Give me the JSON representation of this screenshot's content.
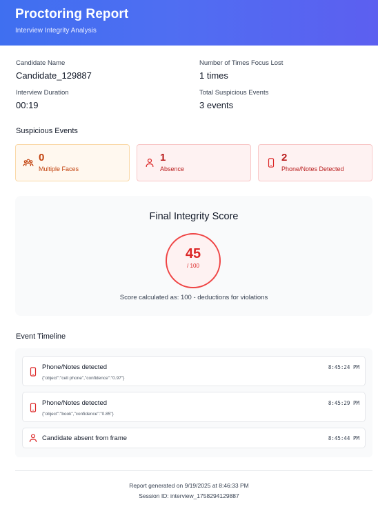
{
  "header": {
    "title": "Proctoring Report",
    "subtitle": "Interview Integrity Analysis"
  },
  "info": {
    "candidate_name_label": "Candidate Name",
    "candidate_name": "Candidate_129887",
    "focus_lost_label": "Number of Times Focus Lost",
    "focus_lost": "1 times",
    "duration_label": "Interview Duration",
    "duration": "00:19",
    "suspicious_total_label": "Total Suspicious Events",
    "suspicious_total": "3 events"
  },
  "suspicious": {
    "title": "Suspicious Events",
    "cards": [
      {
        "count": "0",
        "label": "Multiple Faces",
        "icon": "users-icon",
        "color": "#c2410c"
      },
      {
        "count": "1",
        "label": "Absence",
        "icon": "user-icon",
        "color": "#b91c1c"
      },
      {
        "count": "2",
        "label": "Phone/Notes Detected",
        "icon": "phone-icon",
        "color": "#b91c1c"
      }
    ]
  },
  "score": {
    "title": "Final Integrity Score",
    "value": "45",
    "max": "/ 100",
    "note": "Score calculated as: 100 - deductions for violations",
    "accent": "#dc2626"
  },
  "timeline": {
    "title": "Event Timeline",
    "items": [
      {
        "title": "Phone/Notes detected",
        "detail": "{\"object\":\"cell phone\",\"confidence\":\"0.97\"}",
        "time": "8:45:24 PM",
        "icon": "phone-icon"
      },
      {
        "title": "Phone/Notes detected",
        "detail": "{\"object\":\"book\",\"confidence\":\"0.85\"}",
        "time": "8:45:29 PM",
        "icon": "phone-icon"
      },
      {
        "title": "Candidate absent from frame",
        "time": "8:45:44 PM",
        "icon": "user-icon"
      }
    ]
  },
  "footer": {
    "generated": "Report generated on 9/19/2025 at 8:46:33 PM",
    "session": "Session ID: interview_1758294129887"
  }
}
